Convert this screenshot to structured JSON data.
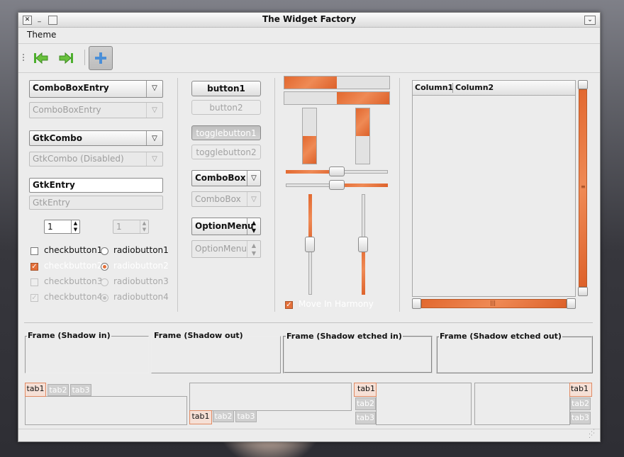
{
  "window": {
    "title": "The Widget Factory"
  },
  "menu": {
    "theme": "Theme"
  },
  "toolbar": {
    "icons": [
      "go-first-icon",
      "go-last-icon",
      "add-icon"
    ]
  },
  "col1": {
    "combo_entry": "ComboBoxEntry",
    "combo_entry_dis": "ComboBoxEntry",
    "gtk_combo": "GtkCombo",
    "gtk_combo_dis": "GtkCombo (Disabled)",
    "entry": "GtkEntry",
    "entry_dis": "GtkEntry",
    "spin": "1",
    "spin_dis": "1",
    "check1": "checkbutton1",
    "check2": "checkbutton2",
    "check3": "checkbutton3",
    "check4": "checkbutton4",
    "radio1": "radiobutton1",
    "radio2": "radiobutton2",
    "radio3": "radiobutton3",
    "radio4": "radiobutton4"
  },
  "col2": {
    "button1": "button1",
    "button2": "button2",
    "toggle1": "togglebutton1",
    "toggle2": "togglebutton2",
    "combobox": "ComboBox",
    "combobox_dis": "ComboBox",
    "option": "OptionMenu",
    "option_dis": "OptionMenu"
  },
  "col3": {
    "progress_h1": 0.5,
    "progress_h2": 0.5,
    "progress_v1": 0.5,
    "progress_v2": 0.5,
    "scale_h1": 0.5,
    "scale_h2": 0.5,
    "scale_v1": 0.5,
    "scale_v2": 0.5,
    "harmony_label": "Move In Harmony"
  },
  "tree": {
    "columns": [
      "Column1",
      "Column2"
    ]
  },
  "frames": [
    "Frame (Shadow in)",
    "Frame (Shadow out)",
    "Frame (Shadow etched in)",
    "Frame (Shadow etched out)"
  ],
  "tabs": [
    "tab1",
    "tab2",
    "tab3"
  ]
}
